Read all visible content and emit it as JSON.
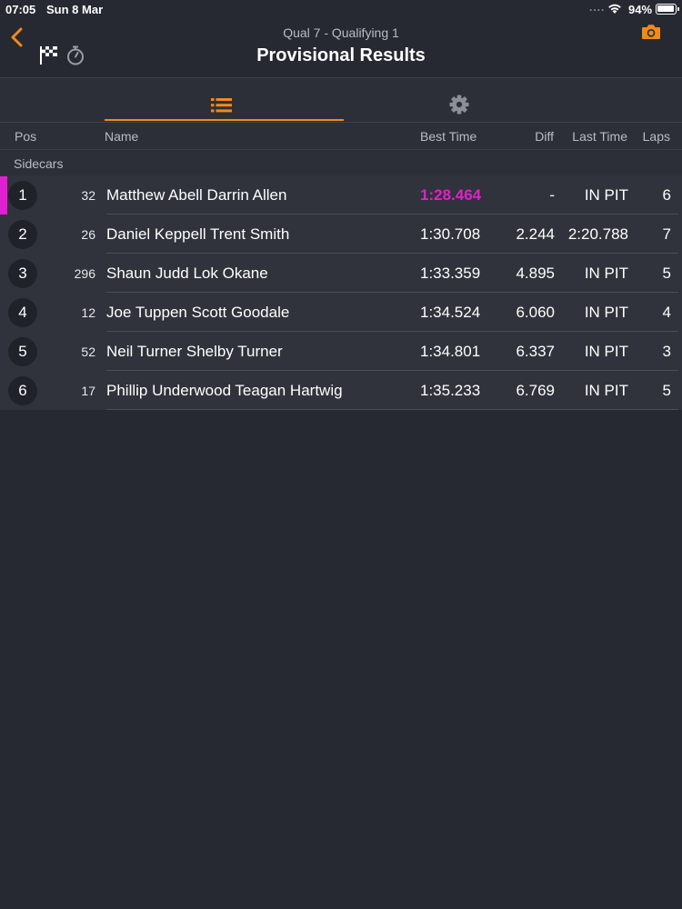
{
  "status_bar": {
    "time": "07:05",
    "date": "Sun 8 Mar",
    "signal": "....",
    "battery": "94%",
    "battery_level": 0.94
  },
  "header": {
    "subtitle": "Qual 7  -  Qualifying 1",
    "title": "Provisional Results"
  },
  "tabs": [
    {
      "icon": "list-icon",
      "active": true
    },
    {
      "icon": "gear-icon",
      "active": false
    }
  ],
  "columns": {
    "pos": "Pos",
    "name": "Name",
    "best_time": "Best Time",
    "diff": "Diff",
    "last_time": "Last Time",
    "laps": "Laps"
  },
  "class_name": "Sidecars",
  "results": [
    {
      "pos": "1",
      "number": "32",
      "name": "Matthew Abell Darrin Allen",
      "best_time": "1:28.464",
      "diff": "-",
      "last_time": "IN PIT",
      "laps": "6",
      "fastest": true
    },
    {
      "pos": "2",
      "number": "26",
      "name": "Daniel Keppell Trent Smith",
      "best_time": "1:30.708",
      "diff": "2.244",
      "last_time": "2:20.788",
      "laps": "7",
      "fastest": false
    },
    {
      "pos": "3",
      "number": "296",
      "name": "Shaun Judd Lok Okane",
      "best_time": "1:33.359",
      "diff": "4.895",
      "last_time": "IN PIT",
      "laps": "5",
      "fastest": false
    },
    {
      "pos": "4",
      "number": "12",
      "name": "Joe Tuppen Scott Goodale",
      "best_time": "1:34.524",
      "diff": "6.060",
      "last_time": "IN PIT",
      "laps": "4",
      "fastest": false
    },
    {
      "pos": "5",
      "number": "52",
      "name": "Neil Turner Shelby Turner",
      "best_time": "1:34.801",
      "diff": "6.337",
      "last_time": "IN PIT",
      "laps": "3",
      "fastest": false
    },
    {
      "pos": "6",
      "number": "17",
      "name": "Phillip Underwood Teagan Hartwig",
      "best_time": "1:35.233",
      "diff": "6.769",
      "last_time": "IN PIT",
      "laps": "5",
      "fastest": false
    }
  ],
  "colors": {
    "accent": "#f08a1c",
    "fastest": "#e21fcf",
    "background": "#262931",
    "row": "#30333b"
  }
}
